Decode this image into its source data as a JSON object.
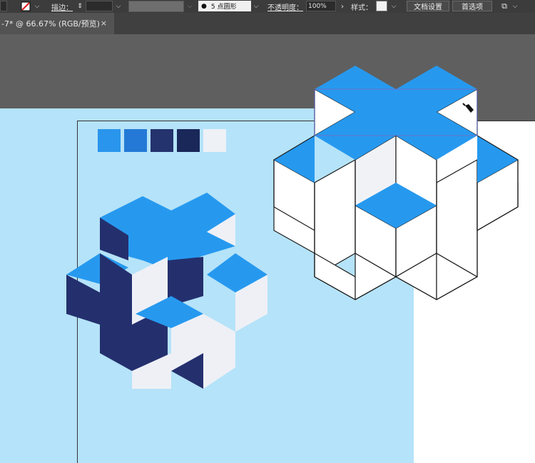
{
  "toolbar": {
    "stroke_label": "描边：",
    "brush_value": "5 点圆形",
    "opacity_label": "不透明度：",
    "opacity_value": "100%",
    "style_label": "样式：",
    "doc_setup_label": "文档设置",
    "preferences_label": "首选项"
  },
  "tab": {
    "title": "-7* @ 66.67% (RGB/预览)",
    "close_glyph": "×"
  },
  "swatches": [
    "#2a95ec",
    "#2479d6",
    "#24326e",
    "#1a2759",
    "#eef1f6"
  ],
  "colors": {
    "blue": "#2699ef",
    "navy": "#24306e",
    "light": "#eef0f6",
    "canvas_bg": "#b5e3f9"
  }
}
